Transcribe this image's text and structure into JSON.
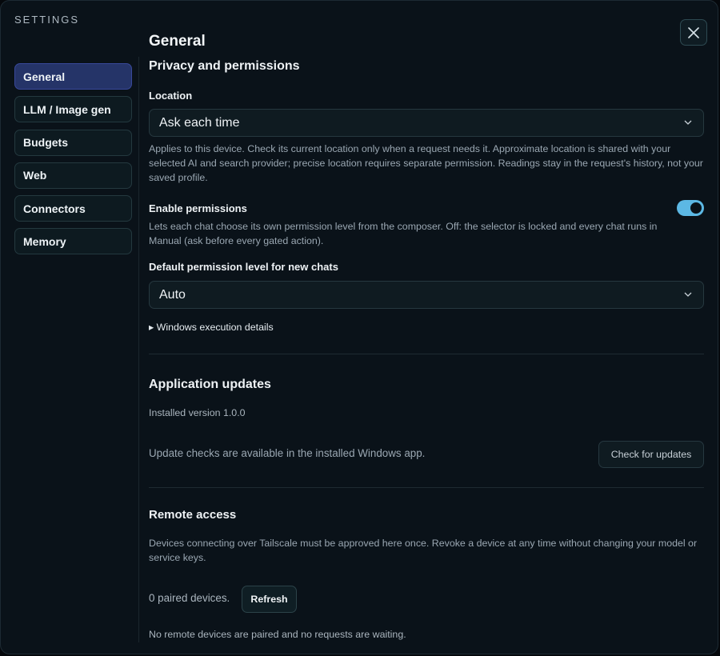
{
  "header": {
    "settings_label": "SETTINGS",
    "close_icon": "close-icon"
  },
  "sidebar": {
    "items": [
      {
        "label": "General",
        "active": true
      },
      {
        "label": "LLM / Image gen",
        "active": false
      },
      {
        "label": "Budgets",
        "active": false
      },
      {
        "label": "Web",
        "active": false
      },
      {
        "label": "Connectors",
        "active": false
      },
      {
        "label": "Memory",
        "active": false
      }
    ]
  },
  "main": {
    "page_title": "General",
    "privacy": {
      "title": "Privacy and permissions",
      "location_label": "Location",
      "location_value": "Ask each time",
      "location_help": "Applies to this device. Check its current location only when a request needs it. Approximate location is shared with your selected AI and search provider; precise location requires separate permission. Readings stay in the request's history, not your saved profile.",
      "enable_label": "Enable permissions",
      "enable_on": true,
      "enable_help": "Lets each chat choose its own permission level from the composer. Off: the selector is locked and every chat runs in Manual (ask before every gated action).",
      "default_label": "Default permission level for new chats",
      "default_value": "Auto",
      "details_label": "▸ Windows execution details"
    },
    "updates": {
      "title": "Application updates",
      "version": "Installed version 1.0.0",
      "note": "Update checks are available in the installed Windows app.",
      "check_button": "Check for updates"
    },
    "remote": {
      "title": "Remote access",
      "help": "Devices connecting over Tailscale must be approved here once. Revoke a device at any time without changing your model or service keys.",
      "paired": "0 paired devices.",
      "refresh_button": "Refresh",
      "status": "No remote devices are paired and no requests are waiting."
    }
  },
  "colors": {
    "accent": "#5cb8e4",
    "active_nav": "#253468",
    "background": "#0a1219"
  }
}
